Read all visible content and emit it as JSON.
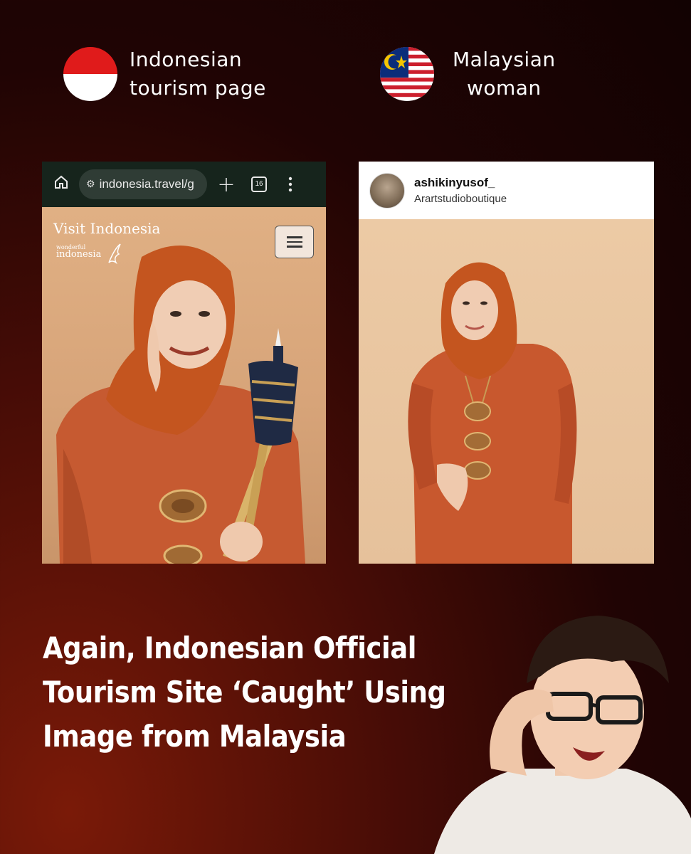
{
  "legend": {
    "indonesia": {
      "line1": "Indonesian",
      "line2": "tourism page",
      "flag": "indonesia-flag"
    },
    "malaysia": {
      "line1": "Malaysian",
      "line2": "woman",
      "flag": "malaysia-flag"
    }
  },
  "browser": {
    "url": "indonesia.travel/g",
    "tab_count": "16",
    "site_title": "Visit Indonesia",
    "logo_small": "wonderful",
    "logo_big": "indonesia"
  },
  "instagram": {
    "username": "ashikinyusof_",
    "subtitle": "Arartstudioboutique"
  },
  "headline": {
    "line1": "Again, Indonesian Official",
    "line2": "Tourism Site ‘Caught’ Using",
    "line3": "Image from Malaysia"
  },
  "colors": {
    "accent_red": "#e01b1b",
    "hijab_orange": "#c4551f",
    "dress_orange": "#c8582e",
    "background_dark": "#200404"
  }
}
